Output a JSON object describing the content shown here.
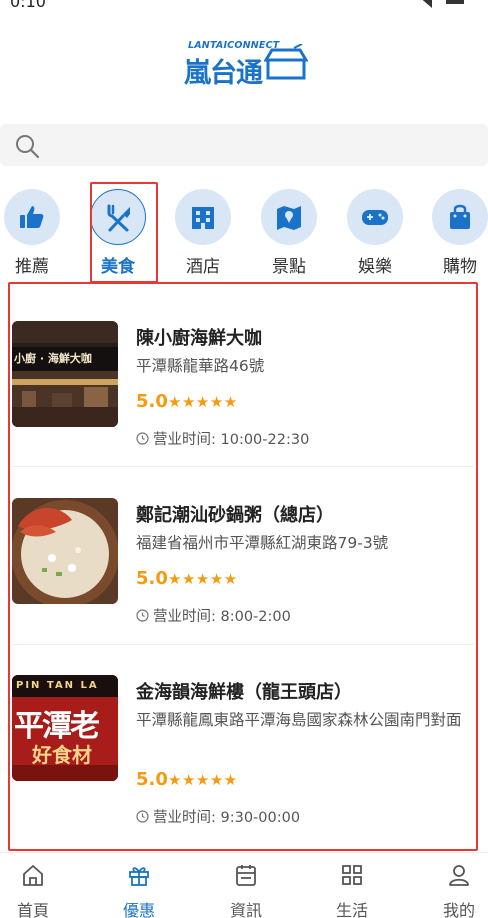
{
  "status_bar": {
    "time": "0:10"
  },
  "logo": {
    "top_text": "LANTAICONNECT",
    "main_text": "嵐台通"
  },
  "search": {
    "placeholder": ""
  },
  "categories": [
    {
      "label": "推薦",
      "icon": "thumbs-up-icon",
      "active": false
    },
    {
      "label": "美食",
      "icon": "utensils-icon",
      "active": true
    },
    {
      "label": "酒店",
      "icon": "hotel-icon",
      "active": false
    },
    {
      "label": "景點",
      "icon": "map-pin-icon",
      "active": false
    },
    {
      "label": "娛樂",
      "icon": "gamepad-icon",
      "active": false
    },
    {
      "label": "購物",
      "icon": "shopping-bag-icon",
      "active": false
    }
  ],
  "restaurants": [
    {
      "name": "陳小廚海鮮大咖",
      "address": "平潭縣龍華路46號",
      "rating": "5.0",
      "stars": "★★★★★",
      "hours_label": "营业时间:",
      "hours": "10:00-22:30",
      "image_text": "小廚 · 海鮮大咖"
    },
    {
      "name": "鄭記潮汕砂鍋粥（總店）",
      "address": "福建省福州市平潭縣紅湖東路79-3號",
      "rating": "5.0",
      "stars": "★★★★★",
      "hours_label": "营业时间:",
      "hours": "8:00-2:00",
      "image_text": ""
    },
    {
      "name": "金海韻海鮮樓（龍王頭店）",
      "address": "平潭縣龍鳳東路平潭海島國家森林公園南門對面",
      "rating": "5.0",
      "stars": "★★★★★",
      "hours_label": "营业时间:",
      "hours": "9:30-00:00",
      "image_text_top": "PIN TAN LA",
      "image_text_mid": "平潭老",
      "image_text_bottom": "好食材"
    }
  ],
  "tabbar": [
    {
      "label": "首頁",
      "icon": "home-icon",
      "active": false
    },
    {
      "label": "優惠",
      "icon": "gift-icon",
      "active": true
    },
    {
      "label": "資訊",
      "icon": "calendar-icon",
      "active": false
    },
    {
      "label": "生活",
      "icon": "grid-icon",
      "active": false
    },
    {
      "label": "我的",
      "icon": "user-icon",
      "active": false
    }
  ],
  "colors": {
    "accent": "#1a73c8",
    "rating": "#f39c12",
    "highlight": "#e53935",
    "category_bg": "#d8e6f6"
  }
}
